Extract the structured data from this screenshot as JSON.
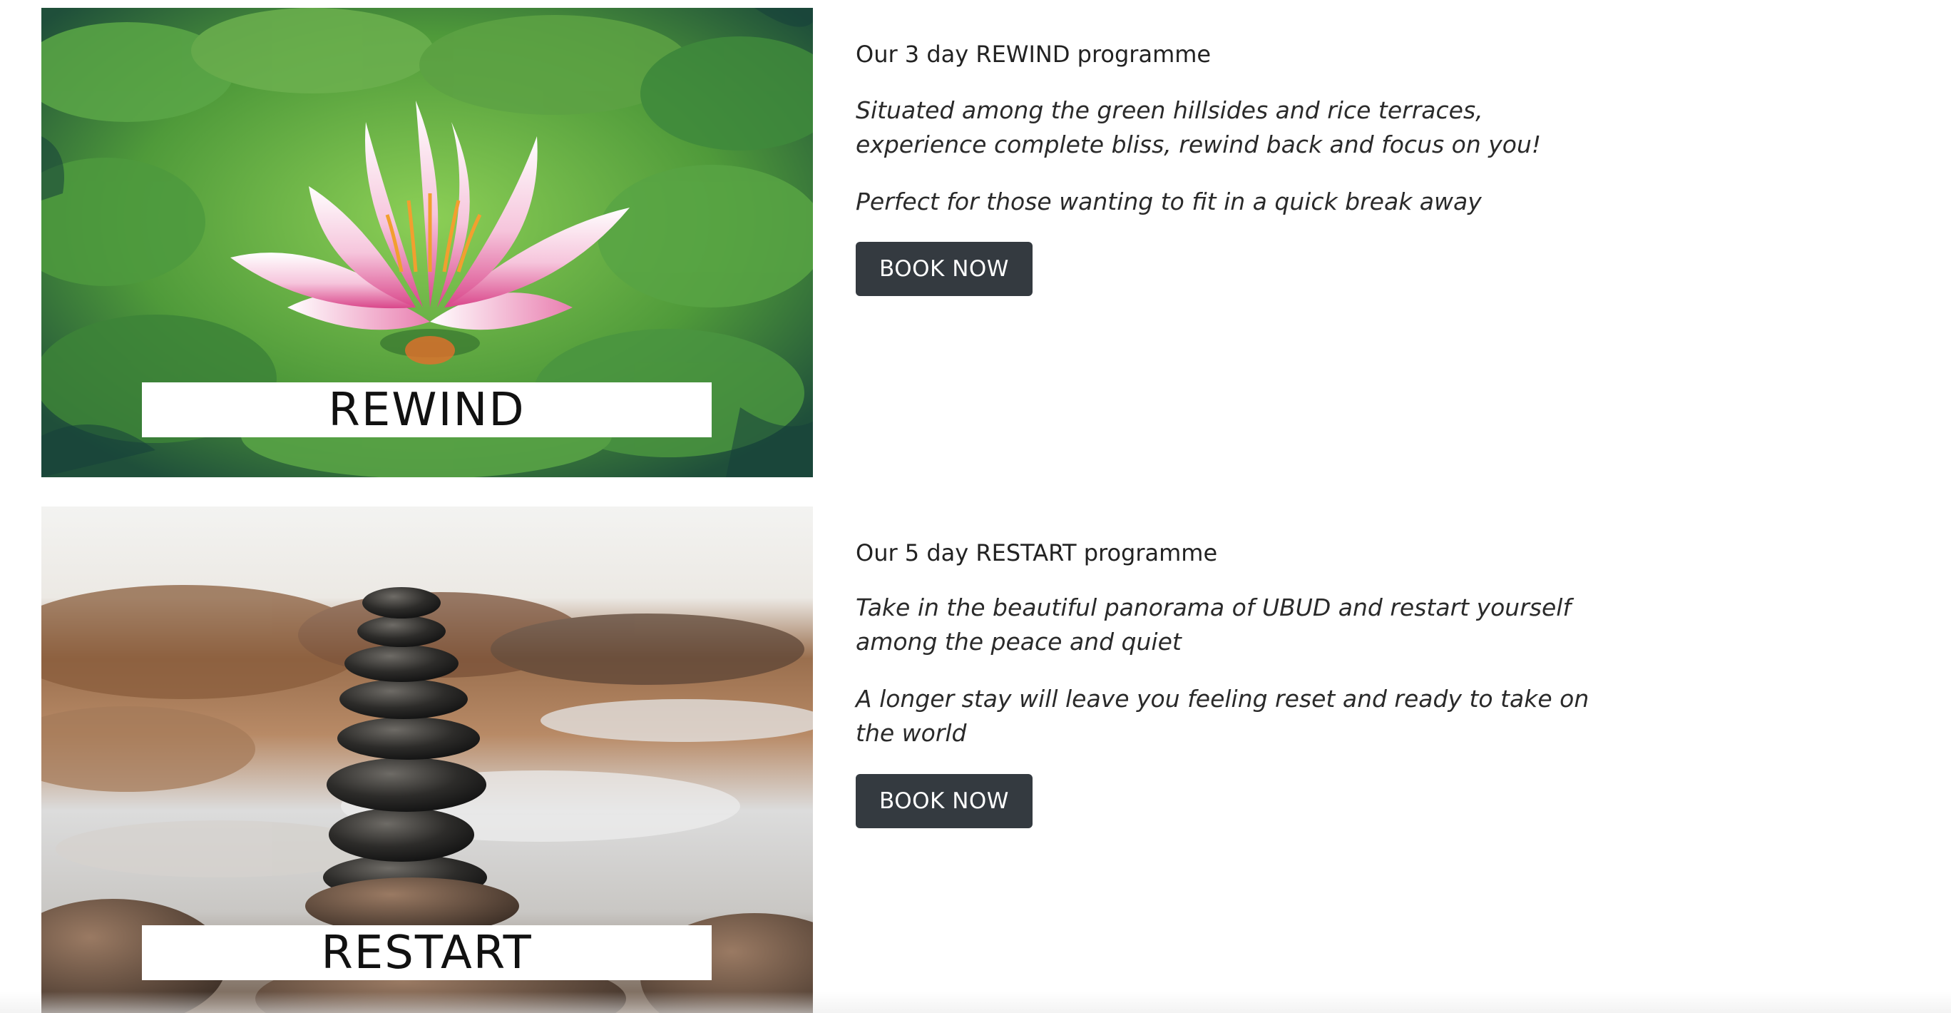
{
  "programmes": [
    {
      "image_alt": "pink water lily on green lily pads",
      "caption": "REWIND",
      "heading": "Our 3 day REWIND programme",
      "description": "Situated among the green hillsides and rice terraces, experience complete bliss, rewind back and focus on you!",
      "tagline": "Perfect for those wanting to fit in a quick break away",
      "button_label": "BOOK NOW"
    },
    {
      "image_alt": "stacked balancing stones by water",
      "caption": "RESTART",
      "heading": "Our 5 day RESTART programme",
      "description": "Take in the beautiful panorama of UBUD and restart yourself among the peace and quiet",
      "tagline": "A longer stay will leave you feeling reset and ready to take on the world",
      "button_label": "BOOK NOW"
    }
  ],
  "colors": {
    "button_bg": "#343a40",
    "button_text": "#ffffff",
    "caption_band": "#ffffff",
    "text": "#212529"
  }
}
